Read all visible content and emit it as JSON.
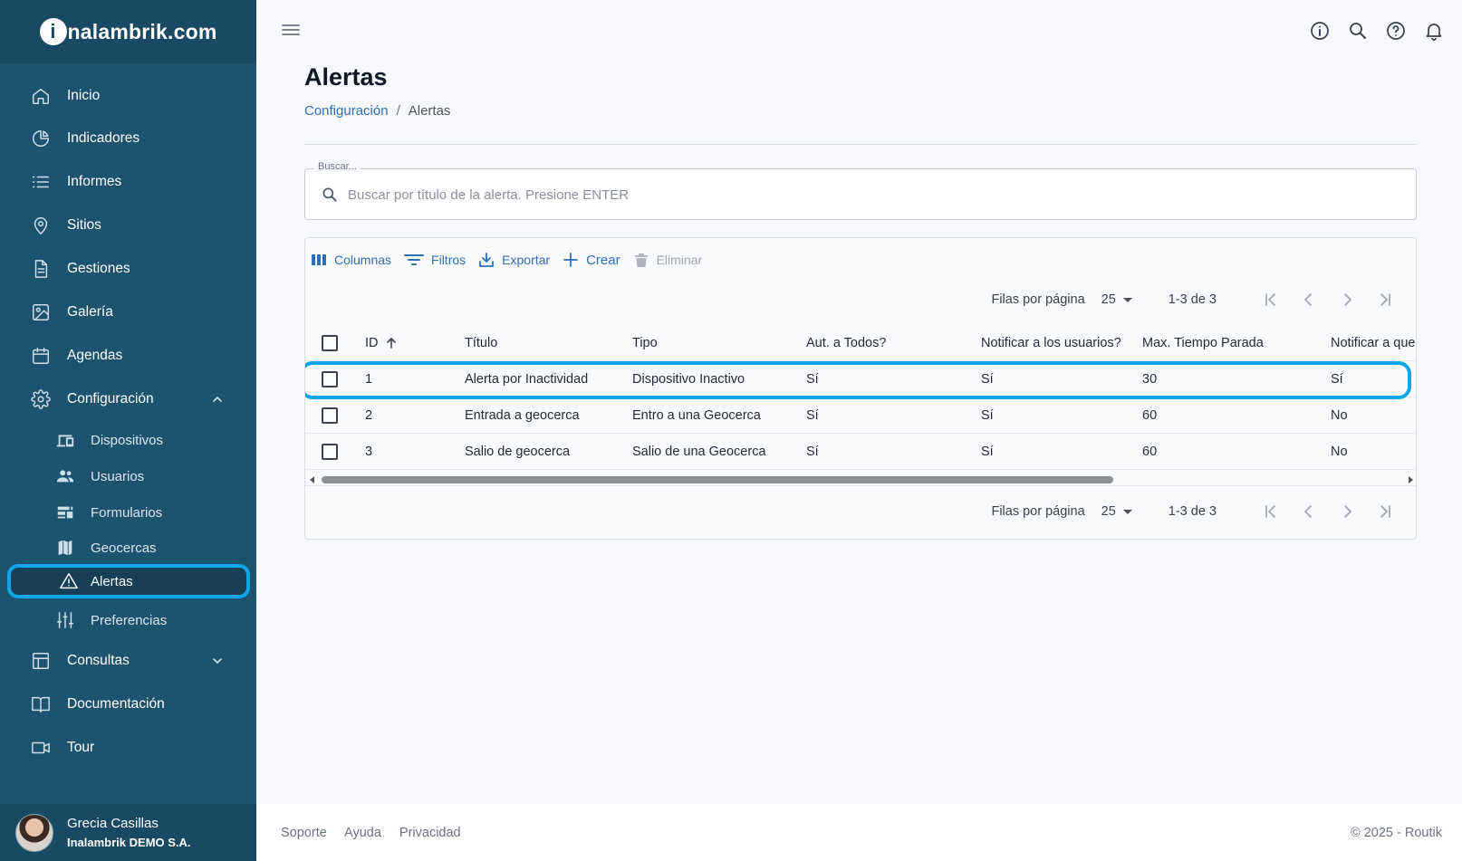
{
  "brand": {
    "logo_initial": "i",
    "logo_text": "nalambrik.com"
  },
  "sidebar": {
    "items": [
      {
        "label": "Inicio"
      },
      {
        "label": "Indicadores"
      },
      {
        "label": "Informes"
      },
      {
        "label": "Sitios"
      },
      {
        "label": "Gestiones"
      },
      {
        "label": "Galería"
      },
      {
        "label": "Agendas"
      },
      {
        "label": "Configuración",
        "expanded": true
      },
      {
        "label": "Consultas",
        "expanded": false
      },
      {
        "label": "Documentación"
      },
      {
        "label": "Tour"
      }
    ],
    "config_children": [
      {
        "label": "Dispositivos"
      },
      {
        "label": "Usuarios"
      },
      {
        "label": "Formularios"
      },
      {
        "label": "Geocercas"
      },
      {
        "label": "Alertas",
        "active": true
      },
      {
        "label": "Preferencias"
      }
    ]
  },
  "user": {
    "name": "Grecia Casillas",
    "org": "Inalambrik DEMO S.A."
  },
  "page": {
    "title": "Alertas",
    "breadcrumb": {
      "parent": "Configuración",
      "separator": "/",
      "current": "Alertas"
    }
  },
  "search": {
    "legend": "Buscar...",
    "placeholder": "Buscar por título de la alerta. Presione ENTER",
    "value": ""
  },
  "toolbar": {
    "columns": "Columnas",
    "filters": "Filtros",
    "export": "Exportar",
    "create": "Crear",
    "delete": "Eliminar"
  },
  "pager": {
    "rows_label": "Filas por página",
    "rows_value": "25",
    "range": "1-3 de 3"
  },
  "table": {
    "headers": [
      "ID",
      "Título",
      "Tipo",
      "Aut. a Todos?",
      "Notificar a los usuarios?",
      "Max. Tiempo Parada",
      "Notificar a que"
    ],
    "rows": [
      [
        "1",
        "Alerta por Inactividad",
        "Dispositivo Inactivo",
        "Sí",
        "Sí",
        "30",
        "Sí"
      ],
      [
        "2",
        "Entrada a geocerca",
        "Entro a una Geocerca",
        "Sí",
        "Sí",
        "60",
        "No"
      ],
      [
        "3",
        "Salio de geocerca",
        "Salio de una Geocerca",
        "Sí",
        "Sí",
        "60",
        "No"
      ]
    ]
  },
  "footer": {
    "links": [
      "Soporte",
      "Ayuda",
      "Privacidad"
    ],
    "copyright": "© 2025 - Routik"
  },
  "colors": {
    "sidebar": "#1c5470",
    "accent": "#2f6fb8",
    "highlight": "#0ea5e9"
  }
}
